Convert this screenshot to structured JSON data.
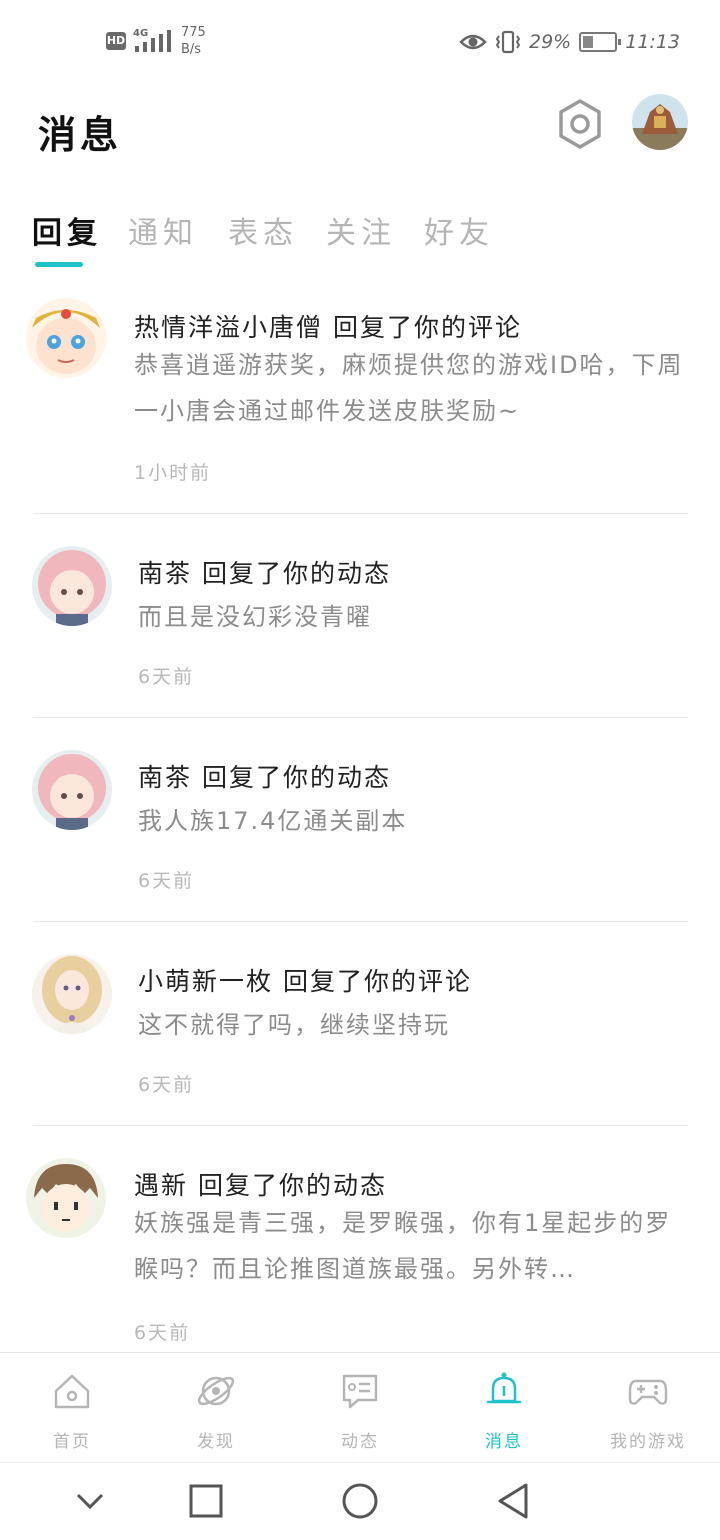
{
  "status_bar": {
    "hd": "HD",
    "network": "4G",
    "speed_value": "775",
    "speed_unit": "B/s",
    "battery_percent": "29%",
    "time": "11:13"
  },
  "header": {
    "title": "消息"
  },
  "tabs": [
    {
      "label": "回复",
      "active": true
    },
    {
      "label": "通知",
      "active": false
    },
    {
      "label": "表态",
      "active": false
    },
    {
      "label": "关注",
      "active": false
    },
    {
      "label": "好友",
      "active": false
    }
  ],
  "messages": [
    {
      "title": "热情洋溢小唐僧  回复了你的评论",
      "body": "恭喜逍遥游获奖，麻烦提供您的游戏ID哈，下周一小唐会通过邮件发送皮肤奖励~",
      "time": "1小时前",
      "avatar": "monk-avatar"
    },
    {
      "title": "南茶  回复了你的动态",
      "body": "而且是没幻彩没青曜",
      "time": "6天前",
      "avatar": "pink-hair-girl-avatar"
    },
    {
      "title": "南茶  回复了你的动态",
      "body": "我人族17.4亿通关副本",
      "time": "6天前",
      "avatar": "pink-hair-girl-avatar"
    },
    {
      "title": "小萌新一枚  回复了你的评论",
      "body": "这不就得了吗，继续坚持玩",
      "time": "6天前",
      "avatar": "blonde-girl-avatar"
    },
    {
      "title": "遇新  回复了你的动态",
      "body": "妖族强是青三强，是罗睺强，你有1星起步的罗睺吗？而且论推图道族最强。另外转…",
      "time": "6天前",
      "avatar": "cartoon-boy-avatar"
    }
  ],
  "bottom_nav": [
    {
      "label": "首页",
      "icon": "home-icon",
      "active": false
    },
    {
      "label": "发现",
      "icon": "planet-icon",
      "active": false
    },
    {
      "label": "动态",
      "icon": "feed-icon",
      "active": false
    },
    {
      "label": "消息",
      "icon": "bell-icon",
      "active": true
    },
    {
      "label": "我的游戏",
      "icon": "gamepad-icon",
      "active": false
    }
  ],
  "colors": {
    "accent": "#1ec3c9",
    "inactive": "#b5b5b5"
  }
}
